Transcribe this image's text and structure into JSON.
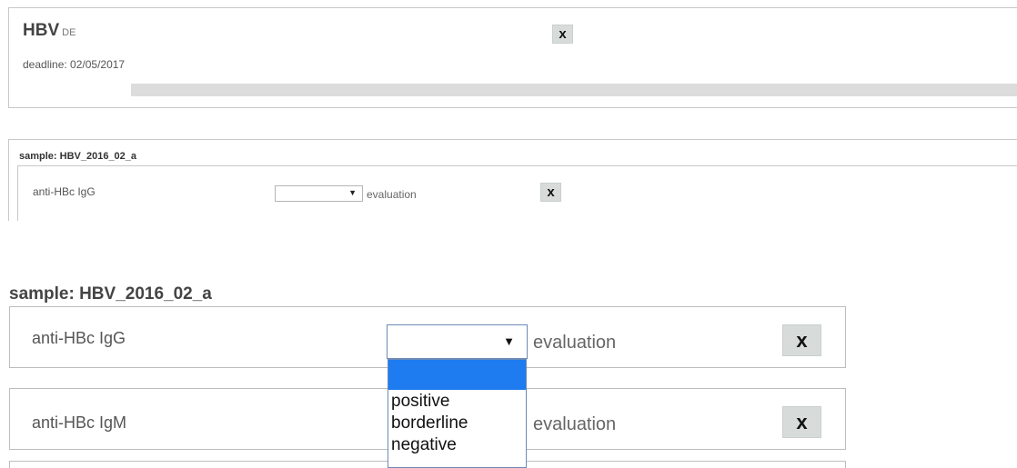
{
  "header": {
    "title": "HBV",
    "language": "DE",
    "deadline": "deadline: 02/05/2017",
    "close_label": "x"
  },
  "small_sample": {
    "title": "sample: HBV_2016_02_a",
    "row": {
      "label": "anti-HBc IgG",
      "select_value": "",
      "arrow": "▼",
      "evaluation_label": "evaluation",
      "close_label": "x"
    }
  },
  "large_sample": {
    "title": "sample: HBV_2016_02_a",
    "rows": [
      {
        "label": "anti-HBc IgG",
        "select_value": "",
        "arrow": "▼",
        "evaluation_label": "evaluation",
        "close_label": "x"
      },
      {
        "label": "anti-HBc IgM",
        "evaluation_label": "evaluation",
        "close_label": "x"
      }
    ],
    "dropdown_options": [
      "",
      "positive",
      "borderline",
      "negative"
    ]
  },
  "colors": {
    "dropdown_highlight": "#1e7cf0",
    "close_button_bg": "#d7dcda",
    "border": "#c8c8c8"
  },
  "icons": [
    "close-icon",
    "chevron-down-icon"
  ]
}
